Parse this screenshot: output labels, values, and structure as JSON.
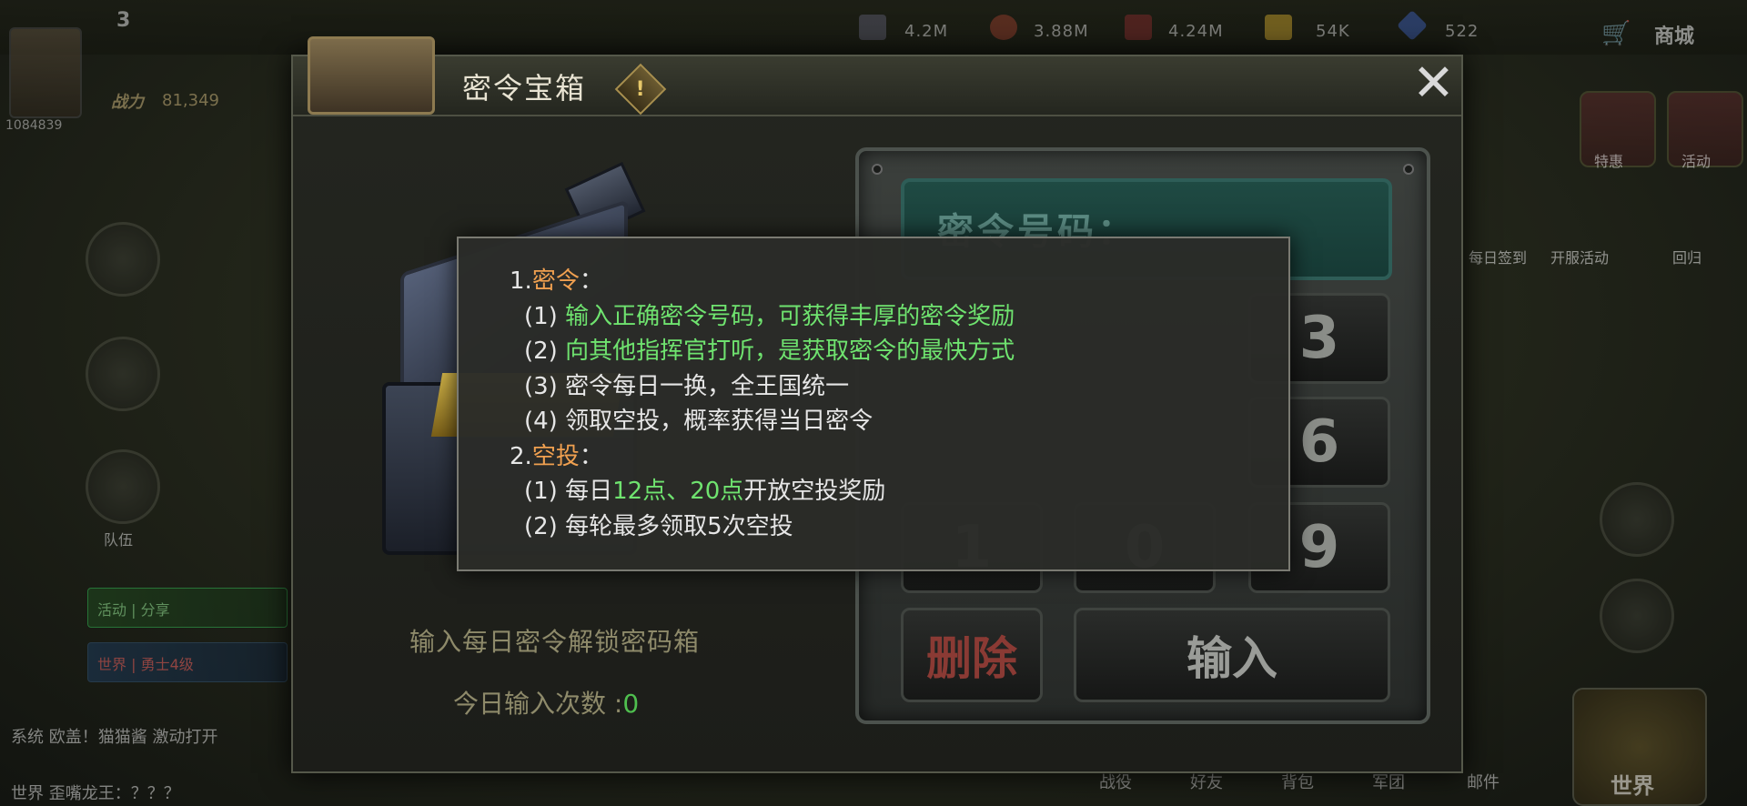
{
  "hud": {
    "level": "3",
    "power_label": "战力",
    "power_value": "81,349",
    "avatar_id": "1084839",
    "resources": [
      "4.2M",
      "3.88M",
      "4.24M",
      "54K",
      "522"
    ],
    "shop_label": "商城",
    "side_label_1": "队伍",
    "right_labels": [
      "特惠",
      "活动"
    ],
    "right_labels_2": [
      "每日签到",
      "开服活动",
      "回归"
    ],
    "event_1": "活动 | 分享",
    "event_2": "世界 | 勇士4级",
    "chat_1": "系统 欧盖！猫猫酱 激动打开",
    "chat_2": "世界 歪嘴龙王：？？？",
    "bottom_tabs": [
      "战役",
      "好友",
      "背包",
      "军团",
      "邮件"
    ],
    "world_label": "世界"
  },
  "panel": {
    "title": "密令宝箱",
    "badge": "!",
    "close": "✕",
    "unlock_hint": "输入每日密令解锁密码箱",
    "count_label": "今日输入次数 :",
    "count_value": "0",
    "code_placeholder": "密令号码："
  },
  "keypad": {
    "keys": [
      "3",
      "6",
      "9",
      "1",
      "0"
    ],
    "delete_label": "删除",
    "input_label": "输入"
  },
  "info": {
    "sec1_prefix": "1.",
    "sec1_title": "密令",
    "sec1_suffix": "：",
    "line1_num": "(1) ",
    "line1_text": "输入正确密令号码，可获得丰厚的密令奖励",
    "line2_num": "(2) ",
    "line2_text": "向其他指挥官打听，是获取密令的最快方式",
    "line3": "(3) 密令每日一换，全王国统一",
    "line4": "(4) 领取空投，概率获得当日密令",
    "sec2_prefix": "2.",
    "sec2_title": "空投",
    "sec2_suffix": "：",
    "line5_pre": "(1) 每日",
    "line5_hl": "12点、20点",
    "line5_post": "开放空投奖励",
    "line6": "(2) 每轮最多领取5次空投"
  },
  "colors": {
    "highlight_orange": "#f0a050",
    "highlight_green": "#6fe36f",
    "count_green": "#4fbf4f"
  }
}
